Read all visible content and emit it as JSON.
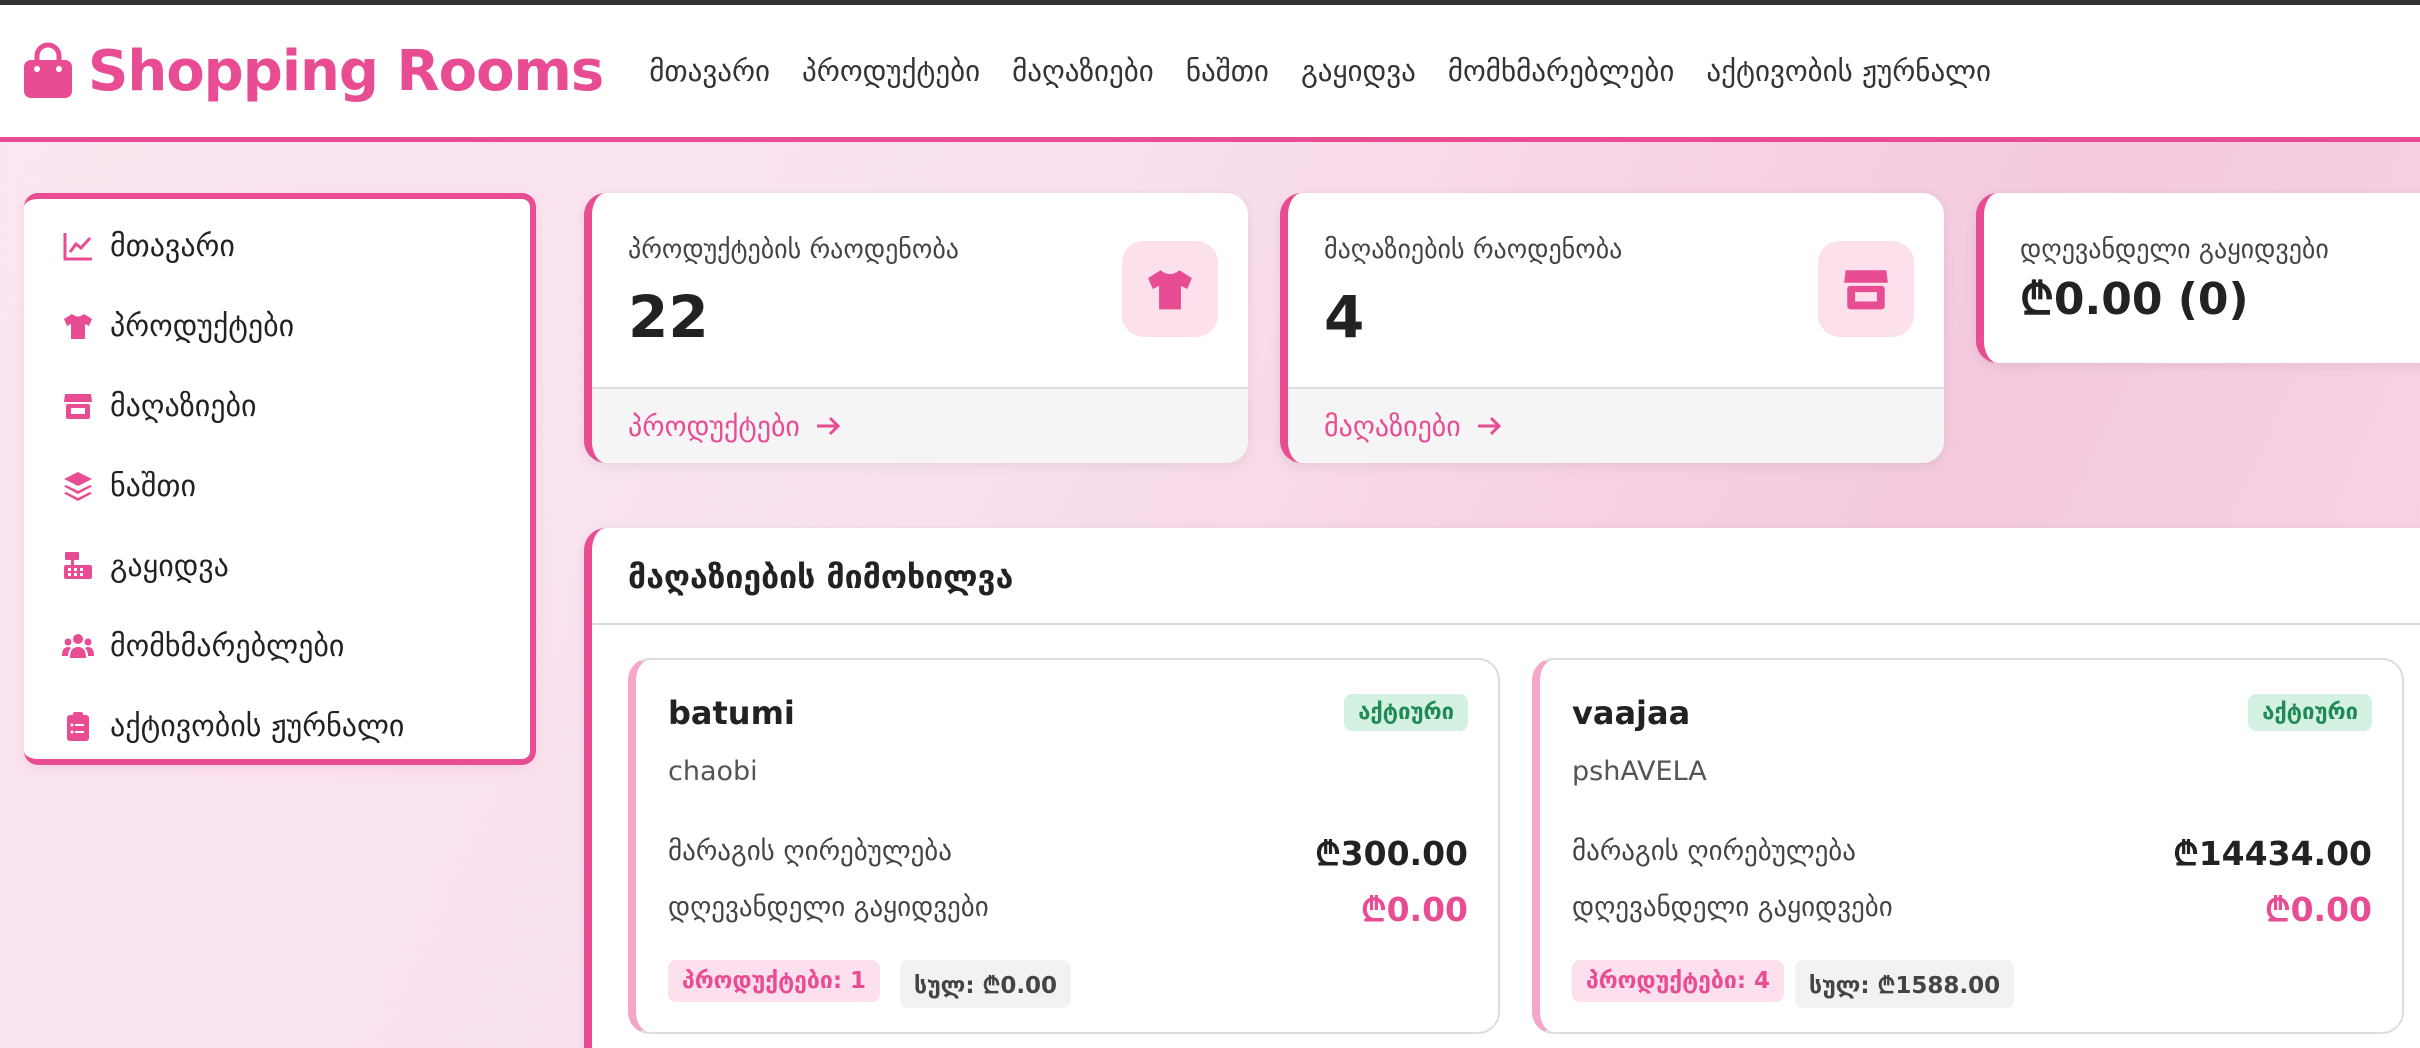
{
  "brand": {
    "name": "Shopping Rooms",
    "icon": "shopping-bag-icon"
  },
  "topnav": [
    "მთავარი",
    "პროდუქტები",
    "მაღაზიები",
    "ნაშთი",
    "გაყიდვა",
    "მომხმარებლები",
    "აქტივობის ჟურნალი"
  ],
  "sidebar": {
    "items": [
      {
        "label": "მთავარი",
        "icon": "chart-line-icon"
      },
      {
        "label": "პროდუქტები",
        "icon": "tshirt-icon"
      },
      {
        "label": "მაღაზიები",
        "icon": "store-icon"
      },
      {
        "label": "ნაშთი",
        "icon": "layers-icon"
      },
      {
        "label": "გაყიდვა",
        "icon": "cash-register-icon"
      },
      {
        "label": "მომხმარებლები",
        "icon": "users-icon"
      },
      {
        "label": "აქტივობის ჟურნალი",
        "icon": "clipboard-icon"
      }
    ]
  },
  "stats": {
    "products": {
      "label": "პროდუქტების რაოდენობა",
      "value": "22",
      "link": "პროდუქტები"
    },
    "stores": {
      "label": "მაღაზიების რაოდენობა",
      "value": "4",
      "link": "მაღაზიები"
    },
    "sales": {
      "label": "დღევანდელი გაყიდვები",
      "value": "₾0.00 (0)"
    }
  },
  "overview": {
    "title": "მაღაზიების მიმოხილვა",
    "stores": [
      {
        "name": "batumi",
        "status": "აქტიური",
        "subtitle": "chaobi",
        "stock_label": "მარაგის ღირებულება",
        "stock_value": "₾300.00",
        "sales_label": "დღევანდელი გაყიდვები",
        "sales_value": "₾0.00",
        "products_tag": "პროდუქტები: 1",
        "total_tag": "სულ: ₾0.00"
      },
      {
        "name": "vaajaa",
        "status": "აქტიური",
        "subtitle": "pshAVELA",
        "stock_label": "მარაგის ღირებულება",
        "stock_value": "₾14434.00",
        "sales_label": "დღევანდელი გაყიდვები",
        "sales_value": "₾0.00",
        "products_tag": "პროდუქტები: 4",
        "total_tag": "სულ: ₾1588.00"
      }
    ]
  },
  "colors": {
    "accent": "#e84c93",
    "active_badge_bg": "#d4f1e2",
    "active_badge_text": "#1f8a55"
  }
}
